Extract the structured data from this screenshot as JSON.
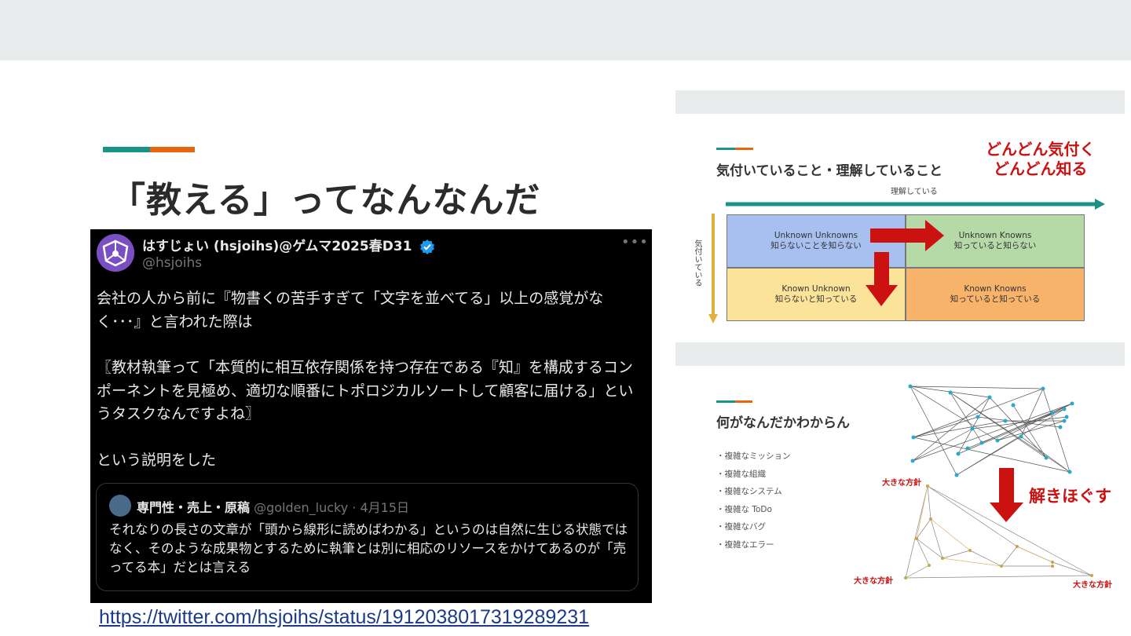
{
  "slide": {
    "title": "「教える」ってなんなんだ",
    "colors": {
      "accent_teal": "#1a9488",
      "accent_orange": "#e8650f",
      "link": "#1a3a8a"
    }
  },
  "tweet": {
    "name": "はすじょい (hsjoihs)@ゲムマ2025春D31",
    "handle": "@hsjoihs",
    "more_icon": "more-icon",
    "verified_icon": "verified-badge-icon",
    "paragraphs": [
      "会社の人から前に『物書くの苦手すぎて「文字を並べてる」以上の感覚がなく･･･』と言われた際は",
      "〖教材執筆って「本質的に相互依存関係を持つ存在である『知』を構成するコンポーネントを見極め、適切な順番にトポロジカルソートして顧客に届ける」というタスクなんですよね〗",
      "という説明をした"
    ],
    "quote": {
      "name": "専門性・売上・原稿",
      "handle": "@golden_lucky",
      "date": "· 4月15日",
      "text": "それなりの長さの文章が「頭から線形に読めばわかる」というのは自然に生じる状態ではなく、そのような成果物とするために執筆とは別に相応のリソースをかけてあるのが「売ってる本」だとは言える"
    }
  },
  "link": {
    "url": "https://twitter.com/hsjoihs/status/1912038017319289231"
  },
  "thumb1": {
    "title": "気付いていること・理解していること",
    "callout": [
      "どんどん気付く",
      "どんどん知る"
    ],
    "x_axis_label": "理解している",
    "y_axis_label": "気付いている",
    "quadrants": [
      {
        "en": "Unknown Unknowns",
        "ja": "知らないことを知らない",
        "color": "#a7c0f0"
      },
      {
        "en": "Unknown Knowns",
        "ja": "知っていると知らない",
        "color": "#b6d9a8"
      },
      {
        "en": "Known Unknown",
        "ja": "知らないと知っている",
        "color": "#fce39a"
      },
      {
        "en": "Known Knowns",
        "ja": "知っていると知っている",
        "color": "#f8b36b"
      }
    ]
  },
  "thumb2": {
    "title": "何がなんだかわからん",
    "list": [
      "・複雑なミッション",
      "・複雑な組織",
      "・複雑なシステム",
      "・複雑な ToDo",
      "・複雑なバグ",
      "・複雑なエラー"
    ],
    "callout": "解きほぐす",
    "labels": [
      "大きな方針",
      "大きな方針",
      "大きな方針"
    ]
  }
}
